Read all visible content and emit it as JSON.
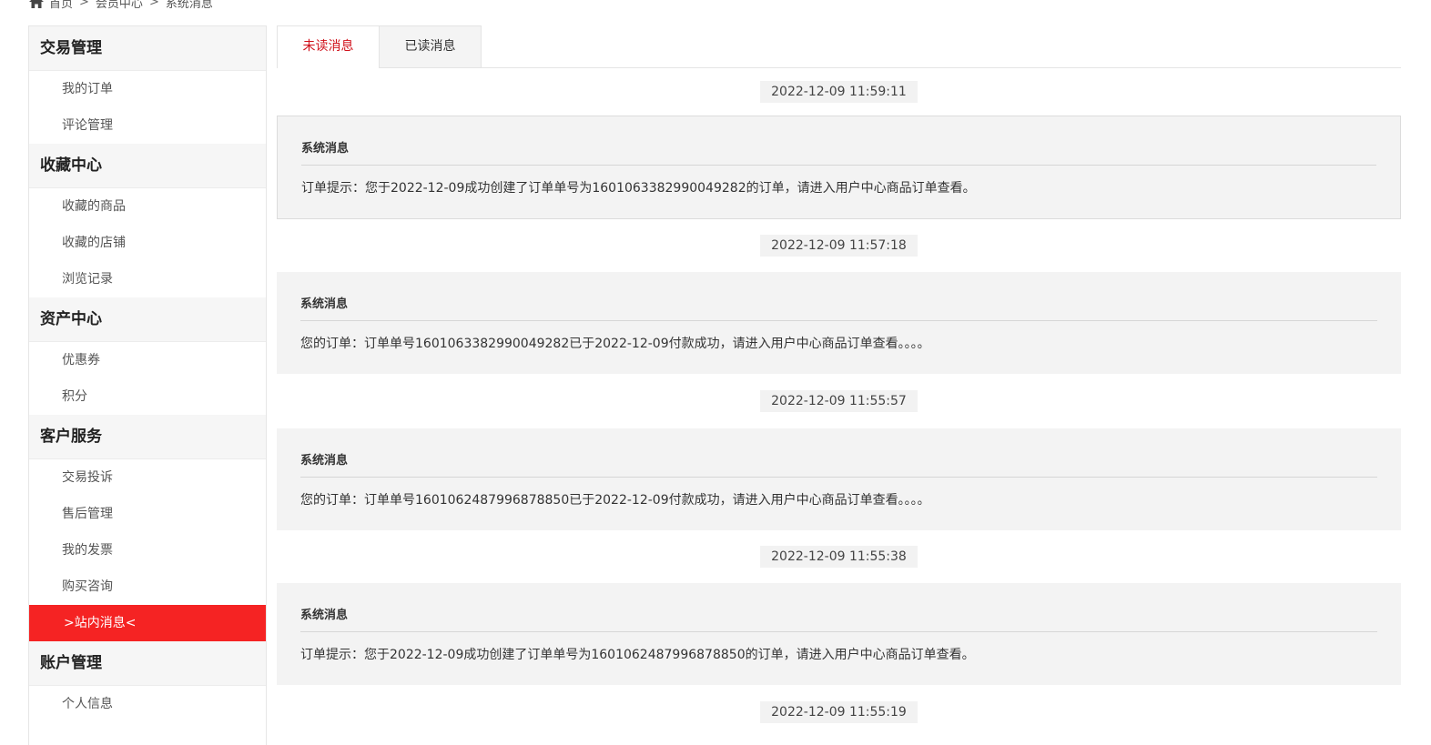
{
  "breadcrumb": {
    "items": [
      "首页",
      "会员中心",
      "系统消息"
    ],
    "separator": ">"
  },
  "sidebar": {
    "groups": [
      {
        "title": "交易管理",
        "items": [
          "我的订单",
          "评论管理"
        ]
      },
      {
        "title": "收藏中心",
        "items": [
          "收藏的商品",
          "收藏的店铺",
          "浏览记录"
        ]
      },
      {
        "title": "资产中心",
        "items": [
          "优惠券",
          "积分"
        ]
      },
      {
        "title": "客户服务",
        "items": [
          "交易投诉",
          "售后管理",
          "我的发票",
          "购买咨询",
          ">站内消息<"
        ]
      },
      {
        "title": "账户管理",
        "items": [
          "个人信息"
        ]
      }
    ],
    "active_item": ">站内消息<"
  },
  "tabs": [
    {
      "label": "未读消息",
      "active": true
    },
    {
      "label": "已读消息",
      "active": false
    }
  ],
  "messages": [
    {
      "time": "2022-12-09 11:59:11",
      "title": "系统消息",
      "body": "订单提示：您于2022-12-09成功创建了订单单号为1601063382990049282的订单，请进入用户中心商品订单查看。"
    },
    {
      "time": "2022-12-09 11:57:18",
      "title": "系统消息",
      "body": "您的订单：订单单号1601063382990049282已于2022-12-09付款成功，请进入用户中心商品订单查看。。。。"
    },
    {
      "time": "2022-12-09 11:55:57",
      "title": "系统消息",
      "body": "您的订单：订单单号1601062487996878850已于2022-12-09付款成功，请进入用户中心商品订单查看。。。。"
    },
    {
      "time": "2022-12-09 11:55:38",
      "title": "系统消息",
      "body": "订单提示：您于2022-12-09成功创建了订单单号为1601062487996878850的订单，请进入用户中心商品订单查看。"
    },
    {
      "time": "2022-12-09 11:55:19"
    }
  ],
  "colors": {
    "accent": "#f52323",
    "tab_active_text": "#d0111b"
  }
}
